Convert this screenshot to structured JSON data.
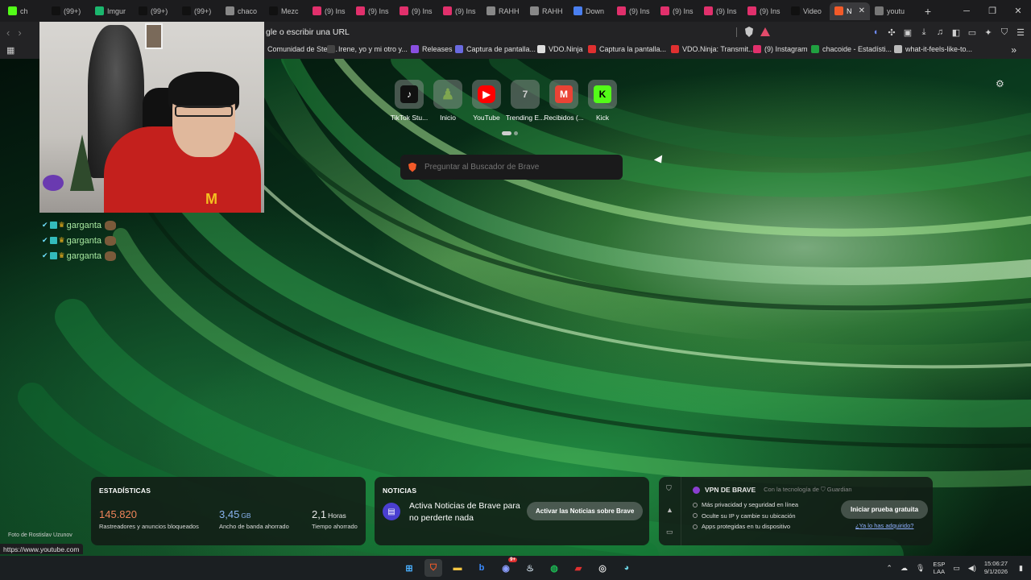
{
  "tabs": [
    {
      "label": "ch",
      "icon": "kick-icon",
      "color": "#53fc18"
    },
    {
      "label": "(99+)",
      "icon": "tiktok-icon",
      "color": "#111111"
    },
    {
      "label": "Imgur",
      "icon": "imgur-icon",
      "color": "#1bb76e"
    },
    {
      "label": "(99+)",
      "icon": "tiktok-icon",
      "color": "#111111"
    },
    {
      "label": "(99+)",
      "icon": "tiktok-icon",
      "color": "#111111"
    },
    {
      "label": "chaco",
      "icon": "trending-icon",
      "color": "#888888"
    },
    {
      "label": "Mezc",
      "icon": "tiktok-icon",
      "color": "#111111"
    },
    {
      "label": "(9) Ins",
      "icon": "instagram-icon",
      "color": "#e1306c"
    },
    {
      "label": "(9) Ins",
      "icon": "instagram-icon",
      "color": "#e1306c"
    },
    {
      "label": "(9) Ins",
      "icon": "instagram-icon",
      "color": "#e1306c"
    },
    {
      "label": "(9) Ins",
      "icon": "instagram-icon",
      "color": "#e1306c"
    },
    {
      "label": "RAHH",
      "icon": "trending-icon",
      "color": "#888888"
    },
    {
      "label": "RAHH",
      "icon": "trending-icon",
      "color": "#888888"
    },
    {
      "label": "Down",
      "icon": "diamond-icon",
      "color": "#4a7ff0"
    },
    {
      "label": "(9) Ins",
      "icon": "instagram-icon",
      "color": "#e1306c"
    },
    {
      "label": "(9) Ins",
      "icon": "instagram-icon",
      "color": "#e1306c"
    },
    {
      "label": "(9) Ins",
      "icon": "instagram-icon",
      "color": "#e1306c"
    },
    {
      "label": "(9) Ins",
      "icon": "instagram-icon",
      "color": "#e1306c"
    },
    {
      "label": "Video",
      "icon": "tiktok-icon",
      "color": "#111111"
    }
  ],
  "active_tab": {
    "label": "N",
    "icon": "brave-icon",
    "color": "#f25a29"
  },
  "last_tab": {
    "label": "youtu",
    "icon": "globe-icon",
    "color": "#777777"
  },
  "address_bar": {
    "placeholder": "gle o escribir una URL"
  },
  "bookmarks": [
    {
      "label": "Comunidad de Stea...",
      "color": "#1b2838"
    },
    {
      "label": "Irene, yo y mi otro y...",
      "color": "#444444"
    },
    {
      "label": "Releases",
      "color": "#8a4fe0"
    },
    {
      "label": "Captura de pantalla...",
      "color": "#6a6ae0"
    },
    {
      "label": "VDO.Ninja",
      "color": "#dddddd"
    },
    {
      "label": "Captura la pantalla...",
      "color": "#e03030"
    },
    {
      "label": "VDO.Ninja: Transmit...",
      "color": "#e03030"
    },
    {
      "label": "(9) Instagram",
      "color": "#e1306c"
    },
    {
      "label": "chacoide - Estadísti...",
      "color": "#20a040"
    },
    {
      "label": "what-it-feels-like-to...",
      "color": "#bbbbbb"
    }
  ],
  "chat": [
    {
      "user": "garganta"
    },
    {
      "user": "garganta"
    },
    {
      "user": "garganta"
    }
  ],
  "top_sites": [
    {
      "label": "TikTok Stu...",
      "icon": "tiktok-icon",
      "color": "#111111"
    },
    {
      "label": "Inicio",
      "icon": "chess-pawn-icon",
      "color": "#7fa650"
    },
    {
      "label": "YouTube",
      "icon": "youtube-icon",
      "color": "#ff0000"
    },
    {
      "label": "Trending E...",
      "icon": "trending-icon",
      "color": "#cfcfcf"
    },
    {
      "label": "Recibidos (...",
      "icon": "gmail-icon",
      "color": "#ea4335"
    },
    {
      "label": "Kick",
      "icon": "kick-icon",
      "color": "#53fc18"
    }
  ],
  "search": {
    "placeholder": "Preguntar al Buscador de Brave"
  },
  "stats": {
    "title": "ESTADÍSTICAS",
    "trackers": {
      "value": "145.820",
      "desc": "Rastreadores y anuncios bloqueados",
      "color": "#f0845a"
    },
    "bandwidth": {
      "value": "3,45",
      "unit": "GB",
      "desc": "Ancho de banda ahorrado",
      "color": "#8ab4f0"
    },
    "time": {
      "value": "2,1",
      "unit": "Horas",
      "desc": "Tiempo ahorrado",
      "color": "#ffffff"
    }
  },
  "news": {
    "title": "NOTICIAS",
    "text": "Activa Noticias de Brave para no perderte nada",
    "button": "Activar las Noticias sobre Brave"
  },
  "vpn": {
    "title": "VPN DE BRAVE",
    "powered": "Con la tecnología de",
    "partner": "Guardian",
    "features": [
      "Más privacidad y seguridad en línea",
      "Oculte su IP y cambie su ubicación",
      "Apps protegidas en tu dispositivo"
    ],
    "button": "Iniciar prueba gratuita",
    "link": "¿Ya lo has adquirido?"
  },
  "photo_credit": "Foto de Rostislav Uzunov",
  "status_url": "https://www.youtube.com",
  "taskbar": {
    "lang_top": "ESP",
    "lang_bottom": "LAA",
    "time": "15:06:27",
    "date": "9/1/2026",
    "discord_badge": "9+"
  }
}
